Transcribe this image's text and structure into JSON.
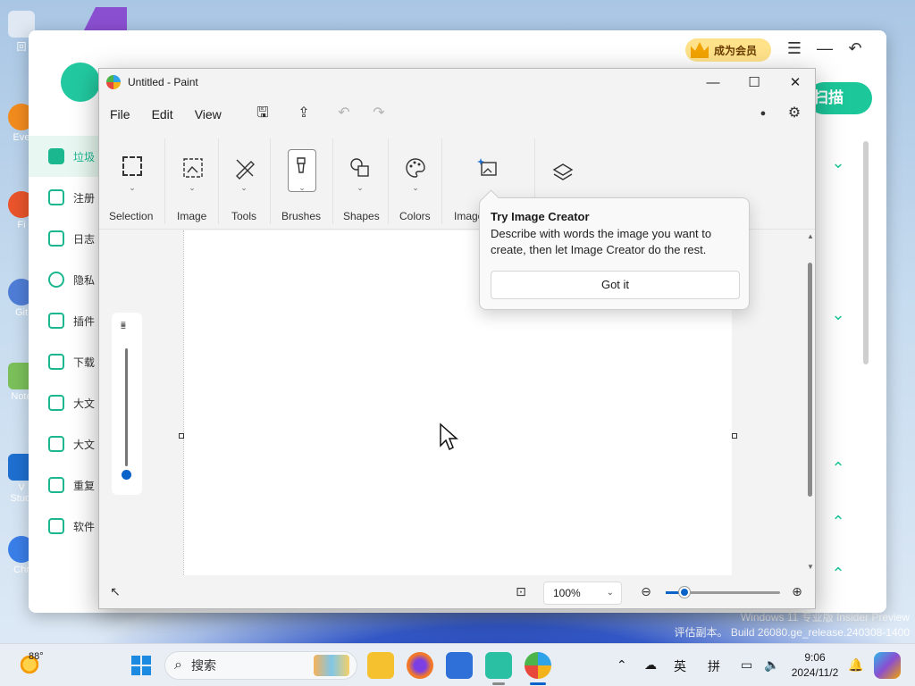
{
  "desktop": {
    "icons": [
      {
        "label": "回"
      },
      {
        "label": "Eve"
      },
      {
        "label": "Fi"
      },
      {
        "label": "Git"
      },
      {
        "label": "Note"
      },
      {
        "label": "V"
      },
      {
        "label": "Studi"
      },
      {
        "label": "Chr"
      }
    ],
    "watermark_line1": "Windows 11 专业版 Insider Preview",
    "watermark_line2": "评估副本。 Build 26080.ge_release.240308-1400"
  },
  "cleaner": {
    "vip_label": "成为会员",
    "scan_label": "扫描",
    "nav": [
      "垃圾",
      "注册",
      "日志",
      "隐私",
      "插件",
      "下载",
      "大文",
      "大文",
      "重复",
      "软件"
    ]
  },
  "paint": {
    "title": "Untitled - Paint",
    "menu": [
      "File",
      "Edit",
      "View"
    ],
    "ribbon": {
      "selection": "Selection",
      "image": "Image",
      "tools": "Tools",
      "brushes": "Brushes",
      "shapes": "Shapes",
      "colors": "Colors",
      "image_creator": "Image"
    },
    "zoom": "100%",
    "accent": "#0a63c8"
  },
  "tip": {
    "title": "Try Image Creator",
    "body": "Describe with words the image you want to create, then let Image Creator do the rest.",
    "button": "Got it"
  },
  "taskbar": {
    "temperature": "88°",
    "search_placeholder": "搜索",
    "ime_lang": "英",
    "ime_mode": "拼",
    "time": "9:06",
    "date": "2024/11/2"
  }
}
